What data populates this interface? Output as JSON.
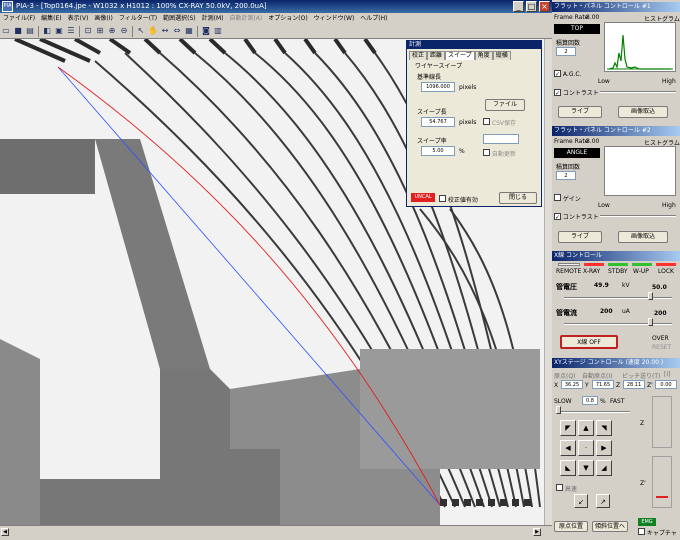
{
  "window": {
    "title": "PIA-3 - [Top0164.jpe - W1032 x H1012 : 100%  CX-RAY  50.0kV, 200.0uA]",
    "app_icon": "PIA",
    "min_label": "_",
    "max_label": "□",
    "close_label": "×"
  },
  "menu": [
    {
      "label": "ファイル(F)",
      "enabled": true
    },
    {
      "label": "編集(E)",
      "enabled": true
    },
    {
      "label": "表示(V)",
      "enabled": true
    },
    {
      "label": "画像(I)",
      "enabled": true
    },
    {
      "label": "フィルター(T)",
      "enabled": true
    },
    {
      "label": "範囲選択(S)",
      "enabled": true
    },
    {
      "label": "計測(M)",
      "enabled": true
    },
    {
      "label": "自動計測(A)",
      "enabled": false
    },
    {
      "label": "オプション(O)",
      "enabled": true
    },
    {
      "label": "ウィンドウ(W)",
      "enabled": true
    },
    {
      "label": "ヘルプ(H)",
      "enabled": true
    }
  ],
  "toolbar_icons": [
    "folder-open-icon",
    "save-icon",
    "print-icon",
    "layers-icon",
    "frame-icon",
    "list-icon",
    "fit-icon",
    "actual-size-icon",
    "zoom-in-icon",
    "zoom-out-icon",
    "pointer-icon",
    "hand-icon",
    "measure-icon",
    "stretch-icon",
    "grid-icon",
    "camera-icon",
    "panel-icon"
  ],
  "calib_dialog": {
    "title": "計測",
    "tabs": [
      "校正",
      "距離",
      "スイープ",
      "角度",
      "縦横"
    ],
    "active_tab": 2,
    "group_label": "ワイヤースイープ",
    "base_length_label": "基準線長",
    "base_length_value": "1096.000",
    "base_length_unit": "pixels",
    "file_button": "ファイル",
    "sweep_length_label": "スイープ長",
    "sweep_length_value": "54.767",
    "sweep_length_unit": "pixels",
    "csv_save_label": "CSV保存",
    "sweep_rate_label": "スイープ率",
    "sweep_rate_value": "5.00",
    "sweep_rate_unit": "%",
    "auto_update_label": "自動更新",
    "uncal_badge": "UNCAL",
    "calib_valid_label": "校正値有効",
    "close_button": "閉じる"
  },
  "fp1": {
    "title": "フラット・パネル コントロール #1",
    "frame_rate_label": "Frame Rate",
    "frame_rate_value": "8.00",
    "hist_label": "ヒストグラム",
    "view_badge": "TOP",
    "accum_label": "積算回数",
    "accum_value": "2",
    "agc_label": "A.G.C.",
    "contrast_label": "コントラスト",
    "low_label": "Low",
    "high_label": "High",
    "live_button": "ライブ",
    "capture_button": "画像取込"
  },
  "fp2": {
    "title": "フラット・パネル コントロール #2",
    "frame_rate_label": "Frame Rate",
    "frame_rate_value": "8.00",
    "hist_label": "ヒストグラム",
    "view_badge": "ANGLE",
    "accum_label": "積算回数",
    "accum_value": "2",
    "gain_label": "ゲイン",
    "contrast_label": "コントラスト",
    "low_label": "Low",
    "high_label": "High",
    "live_button": "ライブ",
    "capture_button": "画像取込"
  },
  "xray": {
    "title": "X線 コントロール",
    "status_labels": [
      "REMOTE",
      "X-RAY",
      "STDBY",
      "W-UP",
      "LOCK"
    ],
    "status_colors": [
      "#f0f0f0",
      "#ff3030",
      "#30c030",
      "#30c030",
      "#ff3030"
    ],
    "voltage_label": "管電圧",
    "voltage_value": "49.9",
    "voltage_unit": "kV",
    "voltage_set": "50.0",
    "current_label": "管電流",
    "current_value": "200",
    "current_unit": "uA",
    "current_set": "200",
    "xray_off_button": "X線 OFF",
    "over_label": "OVER",
    "reset_label": "RESET"
  },
  "stage": {
    "title": "XYステージ コントロール (速度 20.00 )",
    "tab_labels": [
      "原点(Q)",
      "自動原点(I)",
      "ピッチ送り(T)",
      "[I]"
    ],
    "x_label": "X",
    "x_value": "36.25",
    "y_label": "Y",
    "y_value": "71.65",
    "z_label": "Z",
    "z_value": "28.11",
    "z2_label": "Z'",
    "z2_value": "0.00",
    "slow_label": "SLOW",
    "speed_value": "0.8",
    "speed_unit": "%",
    "fast_label": "FAST",
    "z_axis_label": "Z",
    "z2_axis_label": "Z'",
    "lock_label": "高速",
    "origin_button": "原点位置",
    "tilt_button": "傾斜位置へ",
    "emg_badge": "EMG",
    "capture_label": "キャプチャ"
  }
}
